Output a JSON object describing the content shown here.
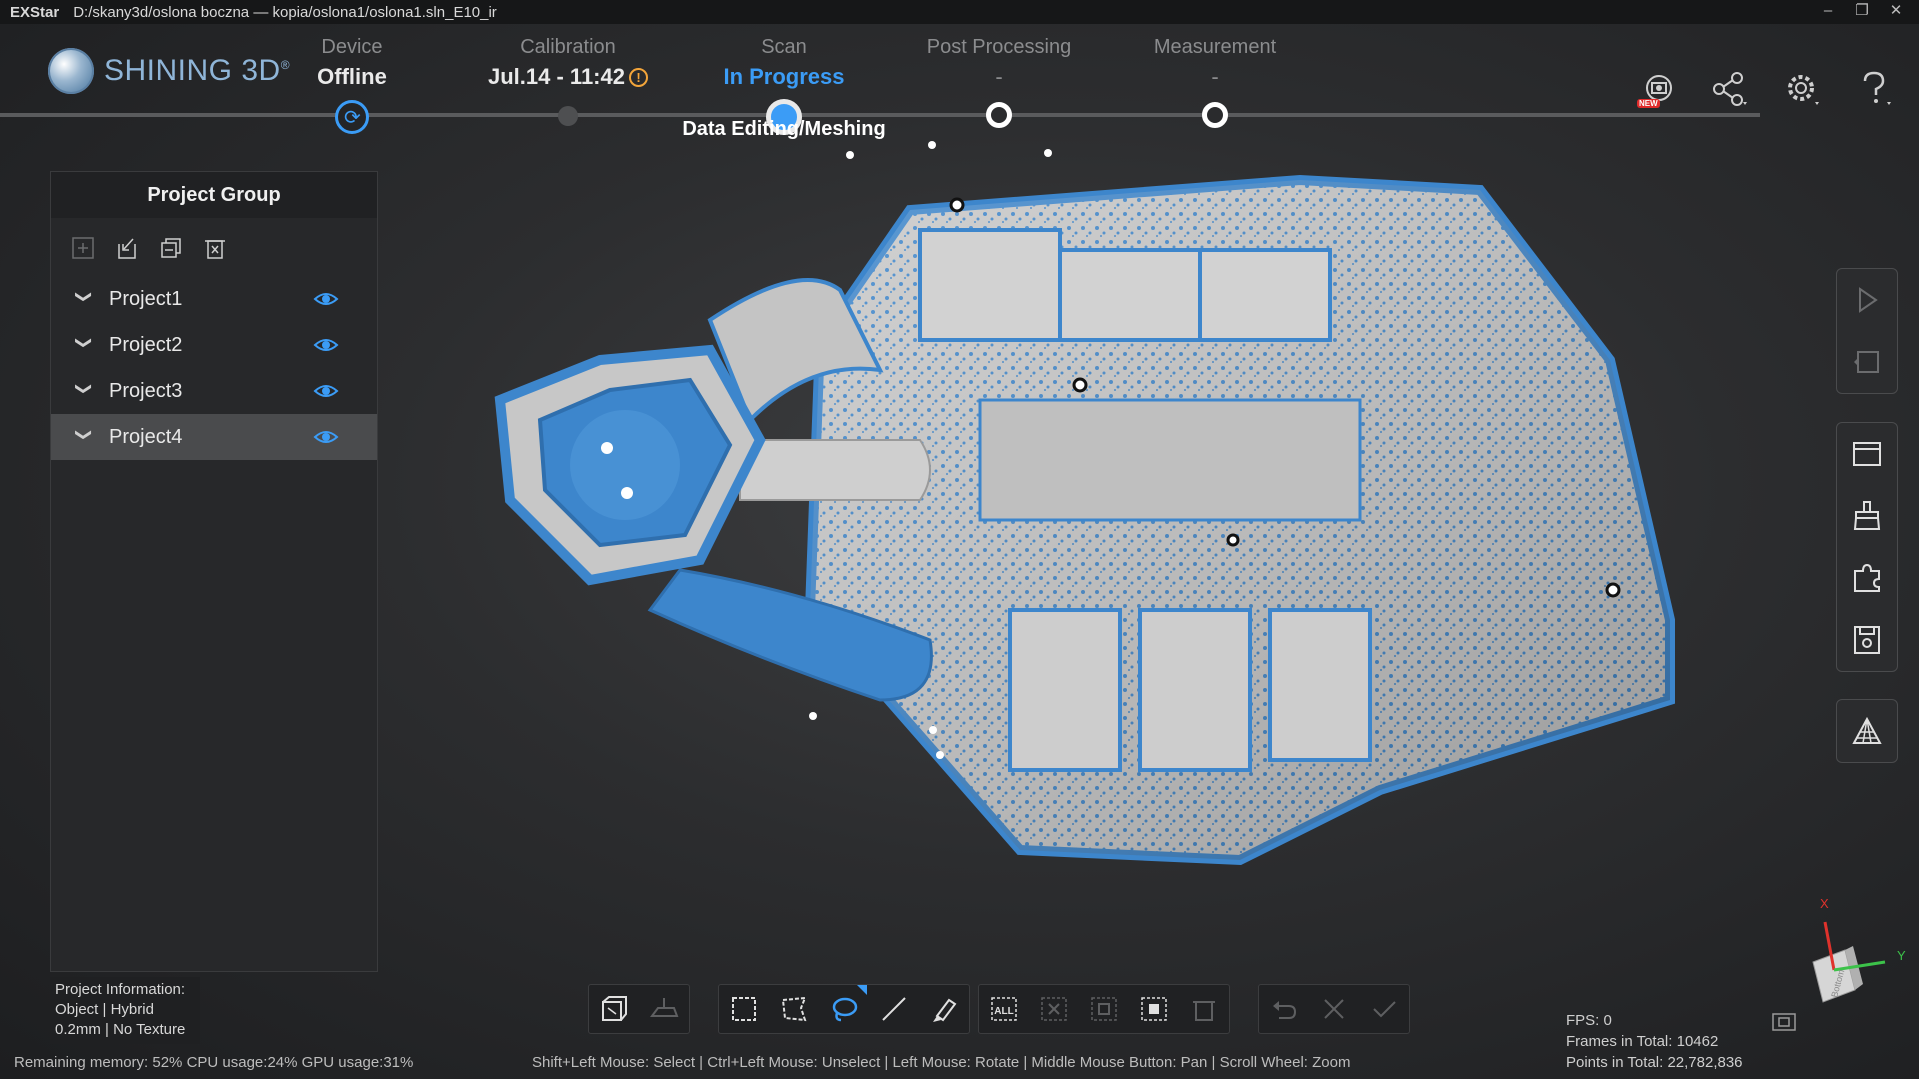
{
  "window": {
    "app_name": "EXStar",
    "path": "D:/skany3d/oslona boczna — kopia/oslona1/oslona1.sln_E10_ir",
    "controls": [
      "–",
      "❐",
      "✕"
    ]
  },
  "brand": {
    "name": "SHINING 3D",
    "mark": "®"
  },
  "steps": [
    {
      "label": "Device",
      "value": "Offline"
    },
    {
      "label": "Calibration",
      "value": "Jul.14 - 11:42",
      "warning": "!"
    },
    {
      "label": "Scan",
      "value": "In Progress"
    },
    {
      "label": "Post Processing",
      "value": "-"
    },
    {
      "label": "Measurement",
      "value": "-"
    }
  ],
  "scan_substatus": "Data Editing/Meshing",
  "header_icons": [
    "scanner-new-icon",
    "share-icon",
    "settings-icon",
    "help-icon"
  ],
  "header_badge": "NEW",
  "project_panel": {
    "title": "Project Group",
    "tools": [
      "add-icon",
      "import-icon",
      "copy-icon",
      "delete-icon"
    ],
    "projects": [
      {
        "name": "Project1",
        "selected": false
      },
      {
        "name": "Project2",
        "selected": false
      },
      {
        "name": "Project3",
        "selected": false
      },
      {
        "name": "Project4",
        "selected": true
      }
    ]
  },
  "project_info": {
    "line1": "Project Information:",
    "line2": "Object | Hybrid",
    "line3": "0.2mm | No Texture"
  },
  "status": {
    "resources": "Remaining memory: 52% CPU usage:24%  GPU usage:31%",
    "hint": "Shift+Left Mouse: Select | Ctrl+Left Mouse: Unselect | Left Mouse: Rotate | Middle Mouse Button: Pan | Scroll Wheel: Zoom"
  },
  "stats": {
    "fps": "FPS: 0",
    "frames": "Frames in Total: 10462",
    "points": "Points in Total: 22,782,836"
  },
  "axis": {
    "x": "X",
    "y": "Y",
    "face": "Bottom"
  },
  "bottom_tools": {
    "select_all_label": "ALL"
  },
  "colors": {
    "accent": "#3b9cf6",
    "scan_blue": "#3d86cc",
    "model_gray": "#c8c8c8",
    "warning": "#f3a53a"
  }
}
